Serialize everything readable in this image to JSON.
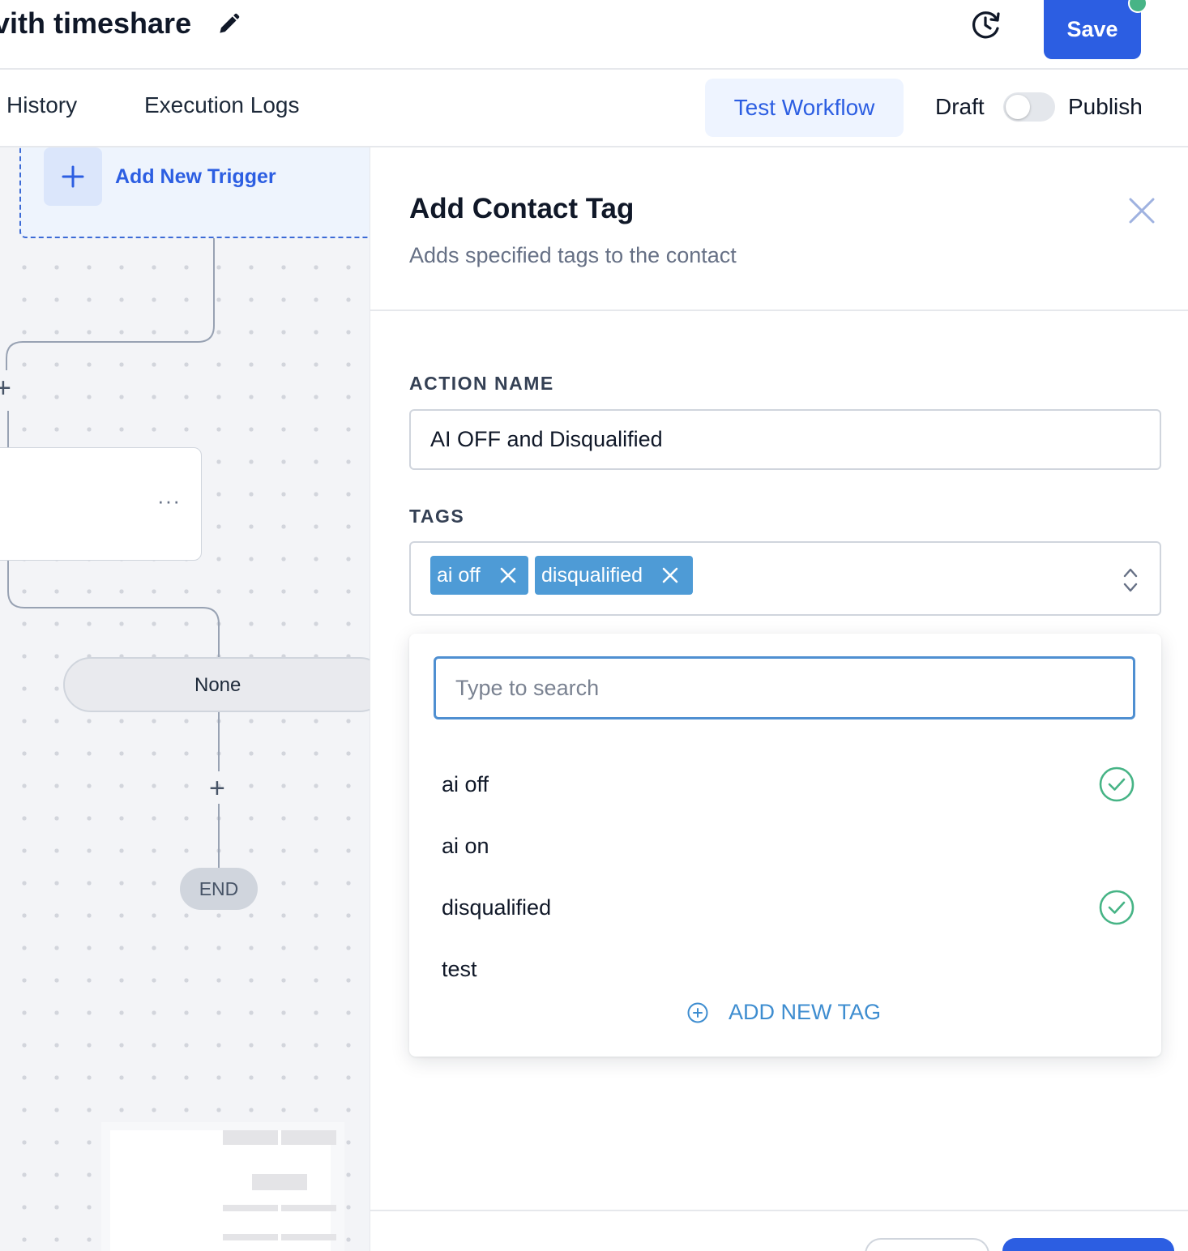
{
  "header": {
    "workflow_title": "vith timeshare",
    "save_label": "Save"
  },
  "tabs": {
    "history": "History",
    "execution_logs": "Execution Logs",
    "test_workflow": "Test Workflow",
    "draft": "Draft",
    "publish": "Publish",
    "publish_enabled": false
  },
  "canvas": {
    "add_trigger_label": "Add New Trigger",
    "branch_label": "None",
    "end_label": "END"
  },
  "panel": {
    "title": "Add Contact Tag",
    "subtitle": "Adds specified tags to the contact",
    "action_name_label": "ACTION NAME",
    "action_name_value": "AI OFF and Disqualified",
    "tags_label": "TAGS",
    "selected_tags": [
      "ai off",
      "disqualified"
    ],
    "search_placeholder": "Type to search",
    "options": [
      {
        "label": "ai off",
        "selected": true
      },
      {
        "label": "ai on",
        "selected": false
      },
      {
        "label": "disqualified",
        "selected": true
      },
      {
        "label": "test",
        "selected": false
      }
    ],
    "add_new_tag_label": "ADD NEW TAG"
  },
  "colors": {
    "primary": "#2c5ee2",
    "chip": "#4e9bd6",
    "check": "#47b486",
    "link": "#3e8dd0"
  },
  "icons": [
    "edit-icon",
    "history-icon",
    "plus-icon",
    "more-icon",
    "close-icon",
    "chevron-updown-icon",
    "check-circle-icon",
    "plus-circle-icon"
  ]
}
